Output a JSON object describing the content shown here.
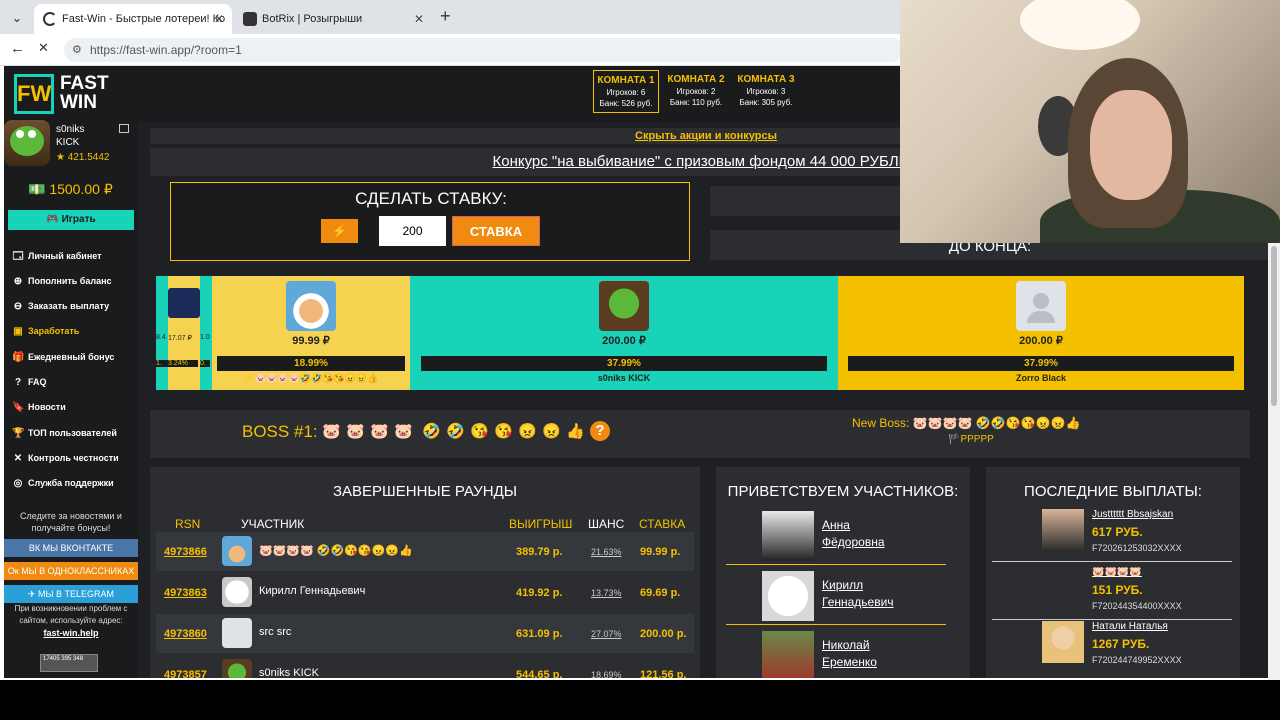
{
  "browser": {
    "tabs": [
      {
        "title": "Fast-Win - Быстрые лотереи! Ко",
        "active": true
      },
      {
        "title": "BotRix | Розыгрыши",
        "active": false
      }
    ],
    "url": "https://fast-win.app/?room=1"
  },
  "logo": {
    "line1": "FAST",
    "line2": "WIN",
    "mark": "FW"
  },
  "user": {
    "name": "s0niks",
    "platform": "KICK",
    "rating": "★ 421.5442",
    "balance": "💵 1500.00 ₽"
  },
  "sidebar": {
    "play_label": "🎮 Играть",
    "menu": [
      {
        "icon": "🗔",
        "label": "Личный кабинет"
      },
      {
        "icon": "⊕",
        "label": "Пополнить баланс"
      },
      {
        "icon": "⊖",
        "label": "Заказать выплату"
      },
      {
        "icon": "▣",
        "label": "Заработать"
      },
      {
        "icon": "🎁",
        "label": "Ежедневный бонус"
      },
      {
        "icon": "?",
        "label": "FAQ"
      },
      {
        "icon": "🔖",
        "label": "Новости"
      },
      {
        "icon": "🏆",
        "label": "ТОП пользователей"
      },
      {
        "icon": "✕",
        "label": "Контроль честности"
      },
      {
        "icon": "◎",
        "label": "Служба поддержки"
      }
    ],
    "follow_line1": "Следите за новостями и",
    "follow_line2": "получайте бонусы!",
    "vk": "ВК МЫ ВКОНТАКТЕ",
    "ok": "Ок МЫ В ОДНОКЛАССНИКАХ",
    "tg": "✈ МЫ В TELEGRAM",
    "problem_line1": "При возникновении проблем с",
    "problem_line2": "сайтом, используйте адрес:",
    "help_url": "fast-win.help",
    "counter_text": "17405 395 348"
  },
  "rooms": [
    {
      "title": "КОМНАТА 1",
      "players": "Игроков: 6",
      "bank": "Банк: 526 руб."
    },
    {
      "title": "КОМНАТА 2",
      "players": "Игроков: 2",
      "bank": "Банк: 110 руб."
    },
    {
      "title": "КОМНАТА 3",
      "players": "Игроков: 3",
      "bank": "Банк: 305 руб."
    }
  ],
  "main": {
    "hide_promos": "Скрыть акции и конкурсы",
    "contest": "Конкурс \"на выбивание\" с призовым фондом 44 000 РУБЛЕЙ",
    "bet_title": "СДЕЛАТЬ СТАВКУ:",
    "bet_bolt": "⚡",
    "bet_amount": "200",
    "bet_button": "СТАВКА",
    "timer_label": "ДО КОНЦА:"
  },
  "tape": {
    "mini": [
      {
        "amount": "8.4",
        "pct": "1."
      },
      {
        "amount": "17.07 ₽",
        "pct": "3.24%"
      },
      {
        "amount": "1.0",
        "pct": "0."
      }
    ],
    "segments": [
      {
        "amount": "99.99 ₽",
        "chance": "18.99%",
        "name": "⚡🐷🐷🐷🐷🤣🤣😘😘😠😠👍",
        "bg": "#f5d24f",
        "avatar": "corgi"
      },
      {
        "amount": "200.00 ₽",
        "chance": "37.99%",
        "name": "s0niks KICK",
        "bg": "#19d3b8",
        "avatar": "bird"
      },
      {
        "amount": "200.00 ₽",
        "chance": "37.99%",
        "name": "Zorro Black",
        "bg": "#f5c000",
        "avatar": "default"
      }
    ]
  },
  "boss": {
    "label": "BOSS #1:",
    "emojis": [
      "🐷",
      "🐷",
      "🐷",
      "🐷",
      "🤣",
      "🤣",
      "😘",
      "😘",
      "😠",
      "😠",
      "👍",
      "?"
    ],
    "new_boss_label": "New Boss:",
    "new_boss_emojis": "🐷🐷🐷🐷 🤣🤣😘😘😠😠👍",
    "new_boss_line2": "🏴PPPPP"
  },
  "rounds": {
    "title": "ЗАВЕРШЕННЫЕ РАУНДЫ",
    "headers": {
      "id": "RSN",
      "participant": "УЧАСТНИК",
      "win": "ВЫИГРЫШ",
      "chance": "ШАНС",
      "stake": "СТАВКА"
    },
    "rows": [
      {
        "id": "4973866",
        "name": "🐷🐷🐷🐷 🤣🤣😘😘😠😠👍",
        "win": "389.79 р.",
        "chance": "21.63%",
        "stake": "99.99 р."
      },
      {
        "id": "4973863",
        "name": "Кирилл Геннадьевич",
        "win": "419.92 р.",
        "chance": "13.73%",
        "stake": "69.69 р."
      },
      {
        "id": "4973860",
        "name": "src src",
        "win": "631.09 р.",
        "chance": "27.07%",
        "stake": "200.00 р."
      },
      {
        "id": "4973857",
        "name": "s0niks KICK",
        "win": "544.65 р.",
        "chance": "18.69%",
        "stake": "121.56 р."
      }
    ]
  },
  "greet": {
    "title": "ПРИВЕТСТВУЕМ УЧАСТНИКОВ:",
    "users": [
      {
        "line1": "Анна",
        "line2": "Фёдоровна"
      },
      {
        "line1": "Кирилл",
        "line2": "Геннадьевич"
      },
      {
        "line1": "Николай",
        "line2": "Еременко"
      }
    ]
  },
  "payouts": {
    "title": "ПОСЛЕДНИЕ ВЫПЛАТЫ:",
    "items": [
      {
        "name": "Justttttt Bbsajskan",
        "amount": "617 РУБ.",
        "wallet": "F720261253032XXXX"
      },
      {
        "name": "🐷🐷🐷🐷",
        "amount": "151 РУБ.",
        "wallet": "F720244354400XXXX"
      },
      {
        "name": "Натали Наталья",
        "amount": "1267 РУБ.",
        "wallet": "F720244749952XXXX"
      }
    ]
  },
  "colors": {
    "accent": "#f5c000",
    "teal": "#19d3b8",
    "orange": "#f08a10",
    "panel": "#2b2d31"
  }
}
